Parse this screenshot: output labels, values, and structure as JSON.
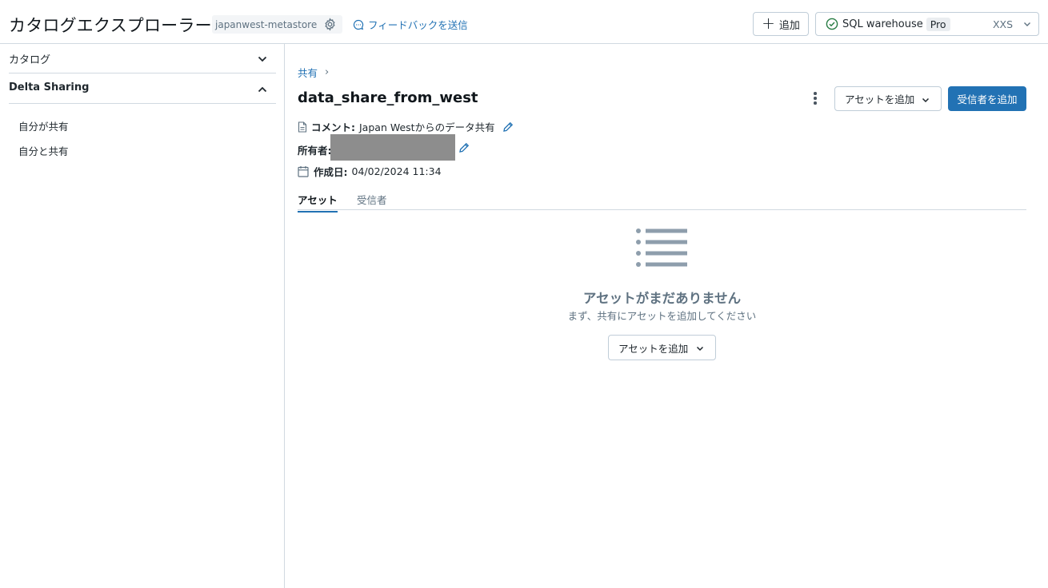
{
  "header": {
    "title": "カタログエクスプローラー",
    "metastore": "japanwest-metastore",
    "feedback_label": "フィードバックを送信",
    "add_label": "追加",
    "warehouse": {
      "name": "SQL warehouse",
      "tier": "Pro",
      "size": "XXS",
      "status_color": "#277c43"
    }
  },
  "sidebar": {
    "sections": [
      {
        "label": "カタログ",
        "expanded": false
      },
      {
        "label": "Delta Sharing",
        "expanded": true
      }
    ],
    "items": [
      {
        "label": "自分が共有"
      },
      {
        "label": "自分と共有"
      }
    ]
  },
  "main": {
    "breadcrumb": {
      "items": [
        "共有"
      ],
      "separator": "›"
    },
    "title": "data_share_from_west",
    "actions": {
      "add_asset_label": "アセットを追加",
      "add_recipient_label": "受信者を追加",
      "primary_color": "#2272b4"
    },
    "comment": {
      "label": "コメント:",
      "value": "Japan Westからのデータ共有"
    },
    "owner": {
      "label": "所有者:"
    },
    "created": {
      "label": "作成日:",
      "value": "04/02/2024 11:34"
    },
    "tabs": [
      {
        "label": "アセット",
        "active": true
      },
      {
        "label": "受信者",
        "active": false
      }
    ],
    "empty_state": {
      "icon": "list-icon",
      "title": "アセットがまだありません",
      "subtitle": "まず、共有にアセットを追加してください",
      "button_label": "アセットを追加"
    }
  }
}
